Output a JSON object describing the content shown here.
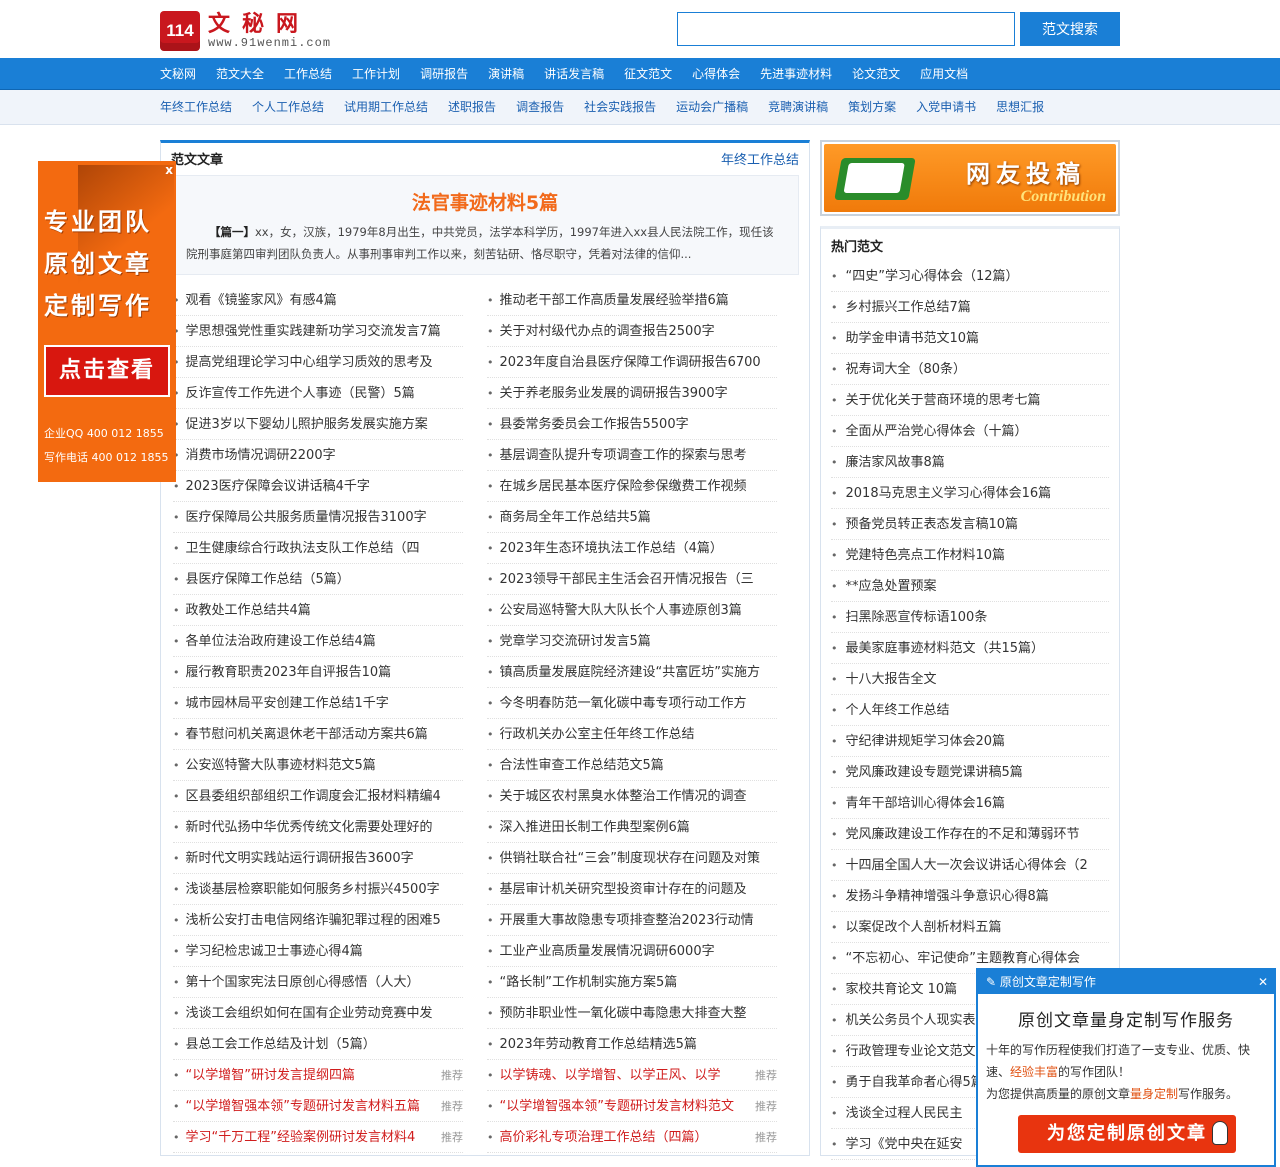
{
  "brand": {
    "logo_mark": "114",
    "name": "文秘网",
    "url": "www.91wenmi.com"
  },
  "search": {
    "placeholder": "",
    "button": "范文搜索"
  },
  "nav_primary": [
    "文秘网",
    "范文大全",
    "工作总结",
    "工作计划",
    "调研报告",
    "演讲稿",
    "讲话发言稿",
    "征文范文",
    "心得体会",
    "先进事迹材料",
    "论文范文",
    "应用文档"
  ],
  "nav_secondary": [
    "年终工作总结",
    "个人工作总结",
    "试用期工作总结",
    "述职报告",
    "调查报告",
    "社会实践报告",
    "运动会广播稿",
    "竞聘演讲稿",
    "策划方案",
    "入党申请书",
    "思想汇报"
  ],
  "main": {
    "title": "范文文章",
    "category": "年终工作总结",
    "feature": {
      "headline": "法官事迹材料5篇",
      "lead": "【篇一】",
      "text": "xx，女，汉族，1979年8月出生，中共党员，法学本科学历，1997年进入xx县人民法院工作，现任该院刑事庭第四审判团队负责人。从事刑事审判工作以来，刻苦钻研、恪尽职守，凭着对法律的信仰..."
    },
    "left_list": [
      "观看《镜鉴家风》有感4篇",
      "学思想强党性重实践建新功学习交流发言7篇",
      "提高党组理论学习中心组学习质效的思考及",
      "反诈宣传工作先进个人事迹（民警）5篇",
      "促进3岁以下婴幼儿照护服务发展实施方案",
      "消费市场情况调研2200字",
      "2023医疗保障会议讲话稿4千字",
      "医疗保障局公共服务质量情况报告3100字",
      "卫生健康综合行政执法支队工作总结（四",
      "县医疗保障工作总结（5篇）",
      "政教处工作总结共4篇",
      "各单位法治政府建设工作总结4篇",
      "履行教育职责2023年自评报告10篇",
      "城市园林局平安创建工作总结1千字",
      "春节慰问机关离退休老干部活动方案共6篇",
      "公安巡特警大队事迹材料范文5篇",
      "区县委组织部组织工作调度会汇报材料精编4",
      "新时代弘扬中华优秀传统文化需要处理好的",
      "新时代文明实践站运行调研报告3600字",
      "浅谈基层检察职能如何服务乡村振兴4500字",
      "浅析公安打击电信网络诈骗犯罪过程的困难5",
      "学习纪检忠诚卫士事迹心得4篇",
      "第十个国家宪法日原创心得感悟（人大）",
      "浅谈工会组织如何在国有企业劳动竞赛中发",
      "县总工会工作总结及计划（5篇）"
    ],
    "right_list": [
      "推动老干部工作高质量发展经验举措6篇",
      "关于对村级代办点的调查报告2500字",
      "2023年度自治县医疗保障工作调研报告6700",
      "关于养老服务业发展的调研报告3900字",
      "县委常务委员会工作报告5500字",
      "基层调查队提升专项调查工作的探索与思考",
      "在城乡居民基本医疗保险参保缴费工作视频",
      "商务局全年工作总结共5篇",
      "2023年生态环境执法工作总结（4篇）",
      "2023领导干部民主生活会召开情况报告（三",
      "公安局巡特警大队大队长个人事迹原创3篇",
      "党章学习交流研讨发言5篇",
      "镇高质量发展庭院经济建设“共富匠坊”实施方",
      "今冬明春防范一氧化碳中毒专项行动工作方",
      "行政机关办公室主任年终工作总结",
      "合法性审查工作总结范文5篇",
      "关于城区农村黑臭水体整治工作情况的调查",
      "深入推进田长制工作典型案例6篇",
      "供销社联合社“三会”制度现状存在问题及对策",
      "基层审计机关研究型投资审计存在的问题及",
      "开展重大事故隐患专项排查整治2023行动情",
      "工业产业高质量发展情况调研6000字",
      "“路长制”工作机制实施方案5篇",
      "预防非职业性一氧化碳中毒隐患大排查大整",
      "2023年劳动教育工作总结精选5篇"
    ],
    "left_recommended": [
      {
        "text": "“以学增智”研讨发言提纲四篇",
        "tag": "推荐"
      },
      {
        "text": "“以学增智强本领”专题研讨发言材料五篇",
        "tag": "推荐"
      },
      {
        "text": "学习“千万工程”经验案例研讨发言材料4",
        "tag": "推荐"
      }
    ],
    "right_recommended": [
      {
        "text": "以学铸魂、以学增智、以学正风、以学",
        "tag": "推荐"
      },
      {
        "text": "“以学增智强本领”专题研讨发言材料范文",
        "tag": "推荐"
      },
      {
        "text": "高价彩礼专项治理工作总结（四篇）",
        "tag": "推荐"
      }
    ]
  },
  "sidebar": {
    "contribute": {
      "title": "网友投稿",
      "subtitle": "Contribution"
    },
    "hot_title": "热门范文",
    "hot_list": [
      "“四史”学习心得体会（12篇）",
      "乡村振兴工作总结7篇",
      "助学金申请书范文10篇",
      "祝寿词大全（80条）",
      "关于优化关于营商环境的思考七篇",
      "全面从严治党心得体会（十篇）",
      "廉洁家风故事8篇",
      "2018马克思主义学习心得体会16篇",
      "预备党员转正表态发言稿10篇",
      "党建特色亮点工作材料10篇",
      "**应急处置预案",
      "扫黑除恶宣传标语100条",
      "最美家庭事迹材料范文（共15篇）",
      "十八大报告全文",
      "个人年终工作总结",
      "守纪律讲规矩学习体会20篇",
      "党风廉政建设专题党课讲稿5篇",
      "青年干部培训心得体会16篇",
      "党风廉政建设工作存在的不足和薄弱环节",
      "十四届全国人大一次会议讲话心得体会（2",
      "发扬斗争精神增强斗争意识心得8篇",
      "以案促改个人剖析材料五篇",
      "“不忘初心、牢记使命”主题教育心得体会",
      "家校共育论文 10篇",
      "机关公务员个人现实表",
      "行政管理专业论文范文",
      "勇于自我革命者心得5篇",
      "浅谈全过程人民民主",
      "学习《党中央在延安"
    ]
  },
  "ad_left": {
    "close": "x",
    "slogan": [
      "专业团队",
      "原创文章",
      "定制写作"
    ],
    "button": "点击查看",
    "qq": "企业QQ  400 012 1855",
    "phone": "写作电话 400 012 1855"
  },
  "popup": {
    "bar_title": "原创文章定制写作",
    "close": "✕",
    "heading": "原创文章量身定制写作服务",
    "line1_a": "十年的写作历程使我们打造了一支专业、优质、快速、",
    "line1_hl": "经验丰富",
    "line1_b": "的写作团队！",
    "line2_a": "为您提供高质量的原创文章",
    "line2_hl": "量身定制",
    "line2_b": "写作服务。",
    "cta": "为您定制原创文章"
  }
}
